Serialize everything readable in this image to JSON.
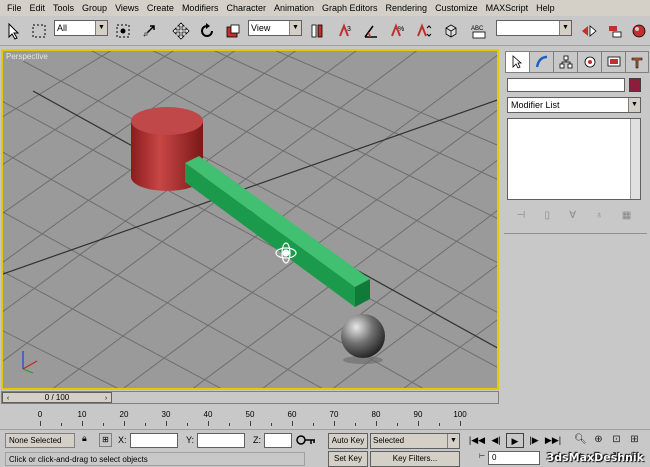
{
  "menu": [
    "File",
    "Edit",
    "Tools",
    "Group",
    "Views",
    "Create",
    "Modifiers",
    "Character",
    "Animation",
    "Graph Editors",
    "Rendering",
    "Customize",
    "MAXScript",
    "Help"
  ],
  "toolbar": {
    "filter_value": "All",
    "refcoord_value": "View",
    "icons": [
      "undo-icon",
      "redo-icon",
      "select-link-icon",
      "unlink-icon",
      "bind-spacewarp-icon",
      "select-filter-dropdown",
      "select-object-icon",
      "select-by-name-icon",
      "rectangle-region-icon",
      "window-crossing-icon",
      "move-icon",
      "rotate-icon",
      "scale-icon",
      "pivot-center-icon",
      "snap-icon",
      "angle-snap-icon",
      "percent-snap-icon",
      "spinner-snap-icon",
      "named-selection-icon",
      "mirror-icon"
    ]
  },
  "viewport": {
    "label": "Perspective"
  },
  "command_panel": {
    "tabs": [
      "create-tab",
      "modify-tab",
      "hierarchy-tab",
      "motion-tab",
      "display-tab",
      "utilities-tab"
    ],
    "object_name": "",
    "object_color": "#8c1e3c",
    "modifier_list": "Modifier List"
  },
  "time": {
    "position_text": "0 / 100",
    "ticks": [
      "0",
      "10",
      "20",
      "30",
      "40",
      "50",
      "60",
      "70",
      "80",
      "90",
      "100"
    ]
  },
  "status": {
    "selection": "None Selected",
    "prompt": "Click or click-and-drag to select objects",
    "x_label": "X:",
    "y_label": "Y:",
    "z_label": "Z:",
    "auto_key": "Auto Key",
    "set_key": "Set Key",
    "key_mode": "Selected",
    "key_filters": "Key Filters...",
    "current_frame": "0"
  },
  "watermark": "3dsMaxDeshnik"
}
